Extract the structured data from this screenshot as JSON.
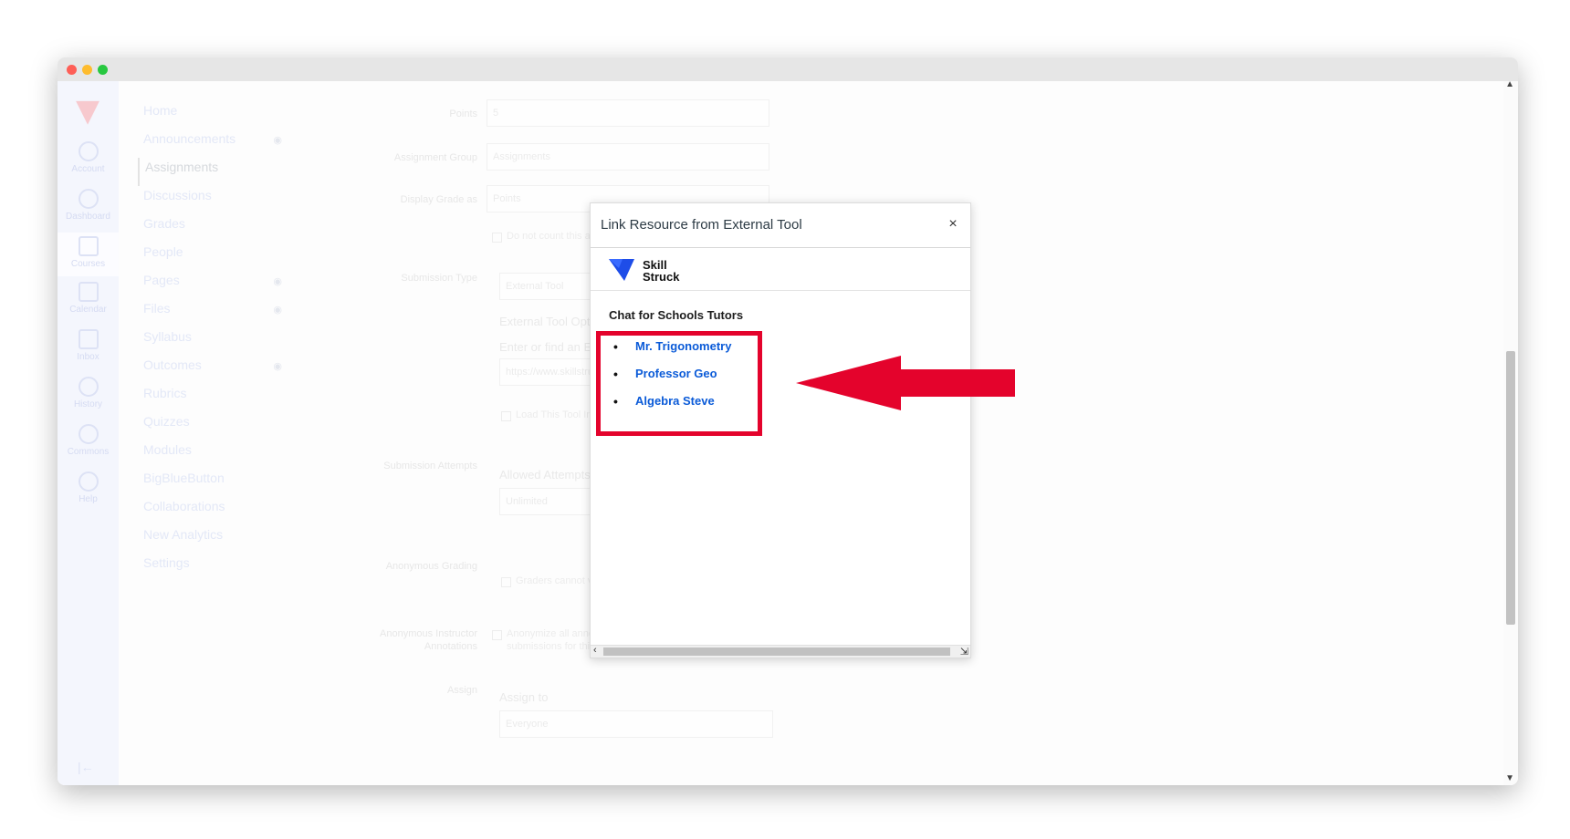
{
  "background_app": {
    "global_nav": [
      {
        "label": "Account",
        "icon": "account-icon"
      },
      {
        "label": "Dashboard",
        "icon": "dashboard-icon"
      },
      {
        "label": "Courses",
        "icon": "courses-icon"
      },
      {
        "label": "Calendar",
        "icon": "calendar-icon"
      },
      {
        "label": "Inbox",
        "icon": "inbox-icon"
      },
      {
        "label": "History",
        "icon": "history-icon"
      },
      {
        "label": "Commons",
        "icon": "commons-icon"
      },
      {
        "label": "Help",
        "icon": "help-icon"
      }
    ],
    "course_nav": [
      "Home",
      "Announcements",
      "Assignments",
      "Discussions",
      "Grades",
      "People",
      "Pages",
      "Files",
      "Syllabus",
      "Outcomes",
      "Rubrics",
      "Quizzes",
      "Modules",
      "BigBlueButton",
      "Collaborations",
      "New Analytics",
      "Settings"
    ],
    "form": {
      "points_label": "Points",
      "points_value": "5",
      "group_label": "Assignment Group",
      "group_value": "Assignments",
      "display_label": "Display Grade as",
      "display_value": "Points",
      "not_count": "Do not count this assignment t",
      "submission_type_label": "Submission Type",
      "submission_type_value": "External Tool",
      "ext_tool_options": "External Tool Options",
      "enter_find": "Enter or find an External To",
      "url_placeholder": "https://www.skillstruck",
      "new_tab": "Load This Tool In A New Tab",
      "attempts_label": "Submission Attempts",
      "allowed_attempts": "Allowed Attempts",
      "attempts_value": "Unlimited",
      "anon_label": "Anonymous Grading",
      "anon_text": "Graders cannot view student",
      "anon_instructor_label_1": "Anonymous Instructor",
      "anon_instructor_label_2": "Annotations",
      "anon_instructor_text_1": "Anonymize all annotations made by instructors on",
      "anon_instructor_text_2": "submissions for this assignment in DocViewer",
      "assign_label": "Assign",
      "assign_to": "Assign to",
      "everyone": "Everyone"
    }
  },
  "modal": {
    "title": "Link Resource from External Tool",
    "close_label": "×",
    "tool_brand_line1": "Skill",
    "tool_brand_line2": "Struck",
    "heading": "Chat for Schools Tutors",
    "tutors": [
      "Mr. Trigonometry",
      "Professor Geo",
      "Algebra Steve"
    ]
  },
  "colors": {
    "link": "#0b5bd8",
    "annotation_red": "#e4032c",
    "brand_blue": "#1e4de8"
  }
}
